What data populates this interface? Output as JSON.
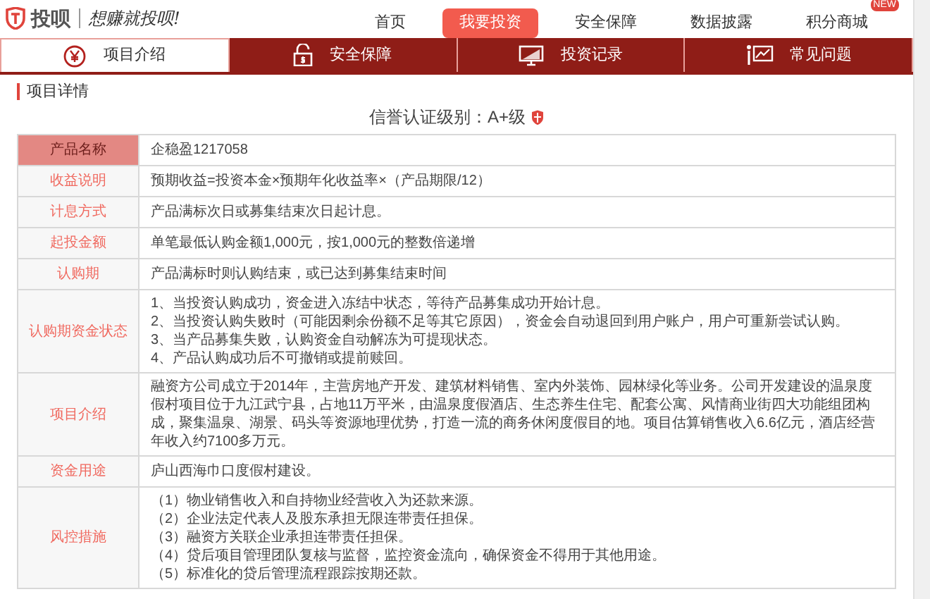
{
  "logo": {
    "brand": "投呗",
    "slogan": "想赚就投呗!"
  },
  "nav": [
    {
      "label": "首页",
      "selected": false
    },
    {
      "label": "我要投资",
      "selected": true
    },
    {
      "label": "安全保障",
      "selected": false
    },
    {
      "label": "数据披露",
      "selected": false
    },
    {
      "label": "积分商城",
      "selected": false,
      "badge": "NEW"
    }
  ],
  "tabs": [
    {
      "label": "项目介绍",
      "selected": true,
      "kind": "yen"
    },
    {
      "label": "安全保障",
      "selected": false,
      "kind": "lock"
    },
    {
      "label": "投资记录",
      "selected": false,
      "kind": "monitor"
    },
    {
      "label": "常见问题",
      "selected": false,
      "kind": "chart"
    }
  ],
  "section_title": "项目详情",
  "credit_rating": "信誉认证级别：A+级",
  "details": [
    {
      "label": "产品名称",
      "selected": true,
      "lines": [
        "企稳盈1217058"
      ]
    },
    {
      "label": "收益说明",
      "selected": false,
      "lines": [
        "预期收益=投资本金×预期年化收益率×（产品期限/12）"
      ]
    },
    {
      "label": "计息方式",
      "selected": false,
      "lines": [
        "产品满标次日或募集结束次日起计息。"
      ]
    },
    {
      "label": "起投金额",
      "selected": false,
      "lines": [
        "单笔最低认购金额1,000元，按1,000元的整数倍递增"
      ]
    },
    {
      "label": "认购期",
      "selected": false,
      "lines": [
        "产品满标时则认购结束，或已达到募集结束时间"
      ]
    },
    {
      "label": "认购期资金状态",
      "selected": false,
      "lines": [
        "1、当投资认购成功，资金进入冻结中状态，等待产品募集成功开始计息。",
        "2、当投资认购失败时（可能因剩余份额不足等其它原因），资金会自动退回到用户账户，用户可重新尝试认购。",
        "3、当产品募集失败，认购资金自动解冻为可提现状态。",
        "4、产品认购成功后不可撤销或提前赎回。"
      ]
    },
    {
      "label": "项目介绍",
      "selected": false,
      "lines": [
        "融资方公司成立于2014年，主营房地产开发、建筑材料销售、室内外装饰、园林绿化等业务。公司开发建设的温泉度假村项目位于九江武宁县，占地11万平米，由温泉度假酒店、生态养生住宅、配套公寓、风情商业街四大功能组团构成，聚集温泉、湖景、码头等资源地理优势，打造一流的商务休闲度假目的地。项目估算销售收入6.6亿元，酒店经营年收入约7100多万元。"
      ]
    },
    {
      "label": "资金用途",
      "selected": false,
      "lines": [
        "庐山西海巾口度假村建设。"
      ]
    },
    {
      "label": "风控措施",
      "selected": false,
      "lines": [
        "（1）物业销售收入和自持物业经营收入为还款来源。",
        "（2）企业法定代表人及股东承担无限连带责任担保。",
        "（3）融资方关联企业承担连带责任担保。",
        "（4）贷后项目管理团队复核与监督，监控资金流向，确保资金不得用于其他用途。",
        "（5）标准化的贷后管理流程跟踪按期还款。"
      ]
    }
  ]
}
